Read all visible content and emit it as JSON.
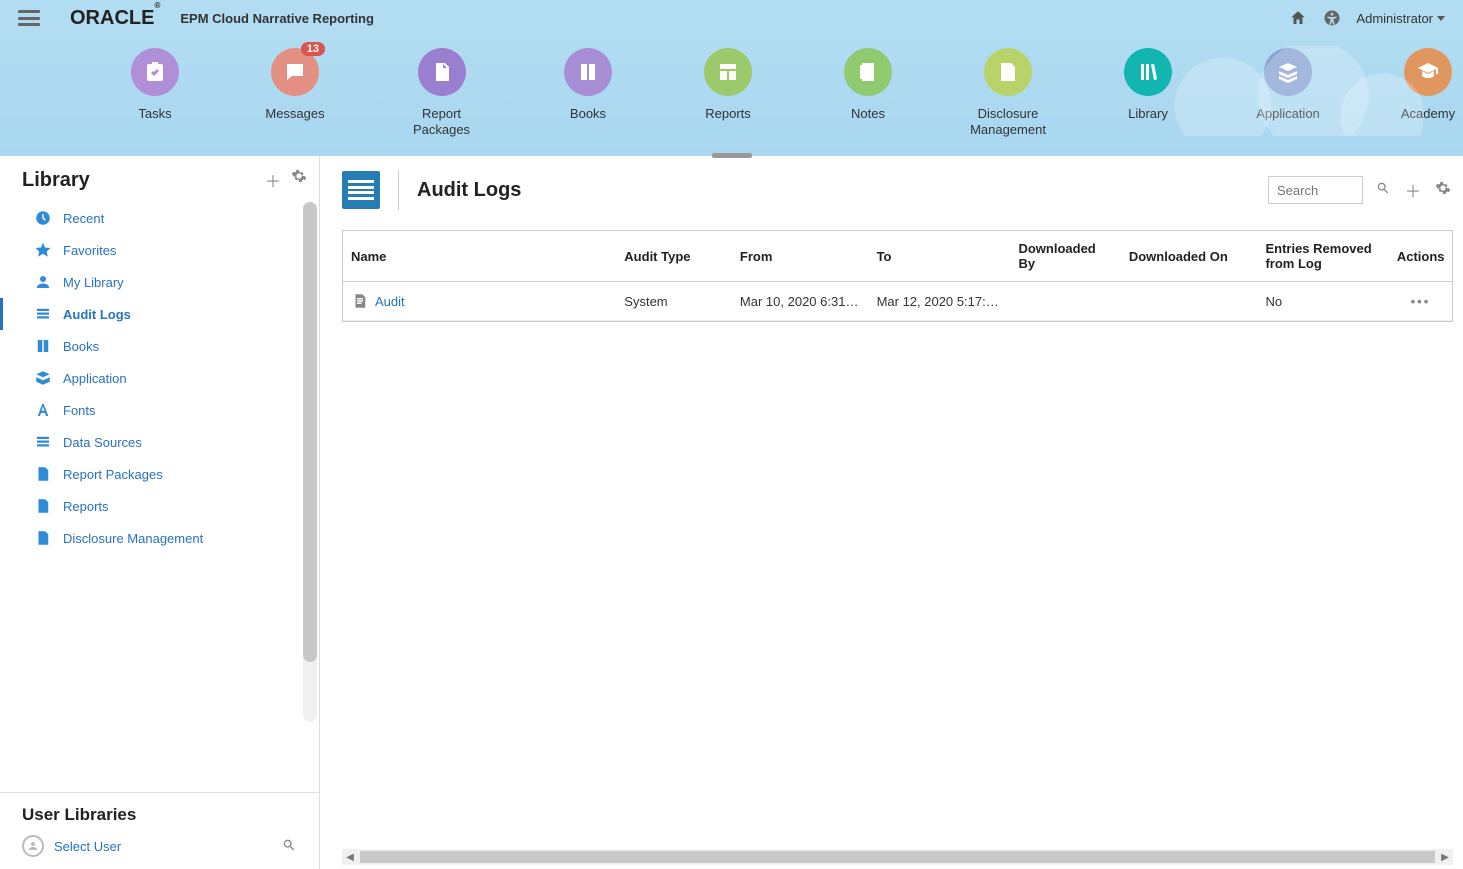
{
  "header": {
    "logo_text": "ORACLE",
    "logo_reg": "®",
    "product": "EPM Cloud Narrative Reporting",
    "user_label": "Administrator"
  },
  "nav": [
    {
      "id": "tasks",
      "label": "Tasks",
      "color": "#b18ed8"
    },
    {
      "id": "messages",
      "label": "Messages",
      "color": "#e48f84",
      "badge": "13"
    },
    {
      "id": "report-packages",
      "label": "Report Packages",
      "color": "#9a7fd1"
    },
    {
      "id": "books",
      "label": "Books",
      "color": "#a88fd5"
    },
    {
      "id": "reports",
      "label": "Reports",
      "color": "#9cc96b"
    },
    {
      "id": "notes",
      "label": "Notes",
      "color": "#8fc970"
    },
    {
      "id": "disclosure-management",
      "label": "Disclosure\nManagement",
      "color": "#b7d36a"
    },
    {
      "id": "library",
      "label": "Library",
      "color": "#13b5b1",
      "active": true
    },
    {
      "id": "application",
      "label": "Application",
      "color": "#8aa3d4"
    },
    {
      "id": "academy",
      "label": "Academy",
      "color": "#e0975f"
    }
  ],
  "sidebar": {
    "title": "Library",
    "items": [
      {
        "id": "recent",
        "label": "Recent"
      },
      {
        "id": "favorites",
        "label": "Favorites"
      },
      {
        "id": "my-library",
        "label": "My Library"
      },
      {
        "id": "audit-logs",
        "label": "Audit Logs",
        "active": true
      },
      {
        "id": "books",
        "label": "Books"
      },
      {
        "id": "application",
        "label": "Application"
      },
      {
        "id": "fonts",
        "label": "Fonts"
      },
      {
        "id": "data-sources",
        "label": "Data Sources"
      },
      {
        "id": "report-packages",
        "label": "Report Packages"
      },
      {
        "id": "reports",
        "label": "Reports"
      },
      {
        "id": "disclosure-management",
        "label": "Disclosure Management"
      }
    ],
    "user_libraries_title": "User Libraries",
    "select_user_label": "Select User"
  },
  "main": {
    "title": "Audit Logs",
    "search_placeholder": "Search",
    "columns": [
      "Name",
      "Audit Type",
      "From",
      "To",
      "Downloaded By",
      "Downloaded On",
      "Entries Removed from Log",
      "Actions"
    ],
    "rows": [
      {
        "name": "Audit",
        "audit_type": "System",
        "from": "Mar 10, 2020 6:31:3…",
        "to": "Mar 12, 2020 5:17:5…",
        "downloaded_by": "",
        "downloaded_on": "",
        "entries_removed": "No"
      }
    ]
  }
}
